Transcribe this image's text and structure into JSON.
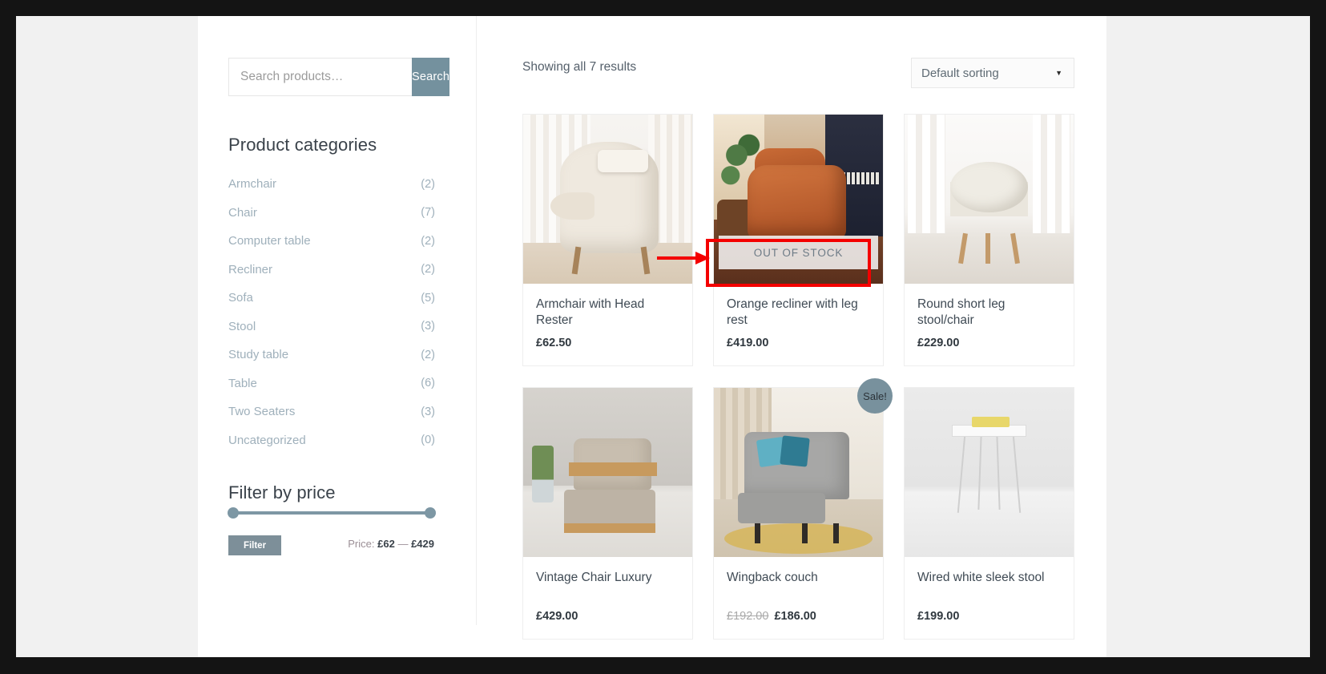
{
  "sidebar": {
    "search": {
      "placeholder": "Search products…",
      "value": "",
      "button_label": "Search"
    },
    "categories_title": "Product categories",
    "categories": [
      {
        "label": "Armchair",
        "count": "(2)"
      },
      {
        "label": "Chair",
        "count": "(7)"
      },
      {
        "label": "Computer table",
        "count": "(2)"
      },
      {
        "label": "Recliner",
        "count": "(2)"
      },
      {
        "label": "Sofa",
        "count": "(5)"
      },
      {
        "label": "Stool",
        "count": "(3)"
      },
      {
        "label": "Study table",
        "count": "(2)"
      },
      {
        "label": "Table",
        "count": "(6)"
      },
      {
        "label": "Two Seaters",
        "count": "(3)"
      },
      {
        "label": "Uncategorized",
        "count": "(0)"
      }
    ],
    "price_filter": {
      "title": "Filter by price",
      "button_label": "Filter",
      "price_prefix": "Price:",
      "min": "£62",
      "separator": "—",
      "max": "£429"
    }
  },
  "main": {
    "result_count": "Showing all 7 results",
    "sorting": {
      "selected": "Default sorting",
      "caret": "chevron-down-icon"
    },
    "products": [
      {
        "title": "Armchair with Head Rester",
        "price": "£62.50",
        "old_price": "",
        "badge": "",
        "stock_banner": ""
      },
      {
        "title": "Orange recliner with leg rest",
        "price": "£419.00",
        "old_price": "",
        "badge": "",
        "stock_banner": "OUT OF STOCK"
      },
      {
        "title": "Round short leg stool/chair",
        "price": "£229.00",
        "old_price": "",
        "badge": "",
        "stock_banner": ""
      },
      {
        "title": "Vintage Chair Luxury",
        "price": "£429.00",
        "old_price": "",
        "badge": "",
        "stock_banner": ""
      },
      {
        "title": "Wingback couch",
        "price": "£186.00",
        "old_price": "£192.00",
        "badge": "Sale!",
        "stock_banner": ""
      },
      {
        "title": "Wired white sleek stool",
        "price": "£199.00",
        "old_price": "",
        "badge": "",
        "stock_banner": ""
      }
    ]
  },
  "annotation": {
    "highlight_color": "#f40000",
    "arrow_color": "#f40000",
    "target": "OUT OF STOCK"
  },
  "theme": {
    "accent": "#74919e",
    "filter_button": "#7d8f99",
    "badge": "#78919d",
    "text": "#3f4a54",
    "muted": "#9fb0bb",
    "page_bg": "#f1f1f1",
    "frame": "#141414"
  }
}
